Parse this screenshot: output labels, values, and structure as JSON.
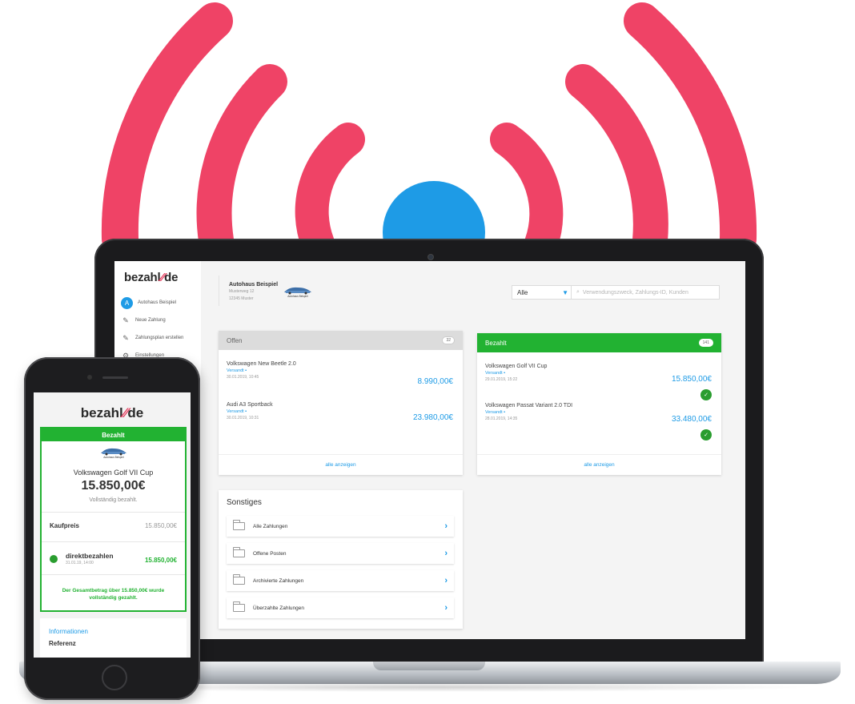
{
  "colors": {
    "wave": "#ef4366",
    "dot": "#1e9be6",
    "accent_green": "#22b232",
    "link_blue": "#1e9be6"
  },
  "desktop": {
    "logo": {
      "text_left": "bezahl",
      "slash": "⁄⁄",
      "text_right": "de"
    },
    "sidebar": {
      "account": {
        "avatar_letter": "A",
        "label": "Autohaus Beispiel"
      },
      "items": [
        {
          "label": "Neue Zahlung",
          "icon": "edit-icon"
        },
        {
          "label": "Zahlungsplan erstellen",
          "icon": "edit-icon"
        },
        {
          "label": "Einstellungen",
          "icon": "gear-icon"
        }
      ]
    },
    "company": {
      "name": "Autohaus Beispiel",
      "street": "Musterweg 12",
      "city": "12345 Muster",
      "logo_caption": "Autohaus Beispiel"
    },
    "filter": {
      "selected": "Alle"
    },
    "search": {
      "placeholder": "Verwendungszweck, Zahlungs-ID, Kunden"
    },
    "open_card": {
      "title": "Offen",
      "count": "32",
      "items": [
        {
          "title": "Volkswagen New Beetle 2.0",
          "status": "Versandt",
          "date": "30.01.2019, 10:45",
          "amount": "8.990,00€"
        },
        {
          "title": "Audi A3 Sportback",
          "status": "Versandt",
          "date": "30.01.2019, 10:31",
          "amount": "23.980,00€"
        }
      ],
      "footer": "alle anzeigen"
    },
    "paid_card": {
      "title": "Bezahlt",
      "count": "141",
      "items": [
        {
          "title": "Volkswagen Golf VII Cup",
          "status": "Versandt",
          "date": "29.01.2019, 15:22",
          "amount": "15.850,00€"
        },
        {
          "title": "Volkswagen Passat Variant 2.0 TDI",
          "status": "Versandt",
          "date": "28.01.2019, 14:35",
          "amount": "33.480,00€"
        }
      ],
      "footer": "alle anzeigen"
    },
    "misc_card": {
      "title": "Sonstiges",
      "items": [
        {
          "label": "Alle Zahlungen"
        },
        {
          "label": "Offene Posten"
        },
        {
          "label": "Archivierte Zahlungen"
        },
        {
          "label": "Überzahlte Zahlungen"
        }
      ]
    }
  },
  "phone": {
    "logo": {
      "text_left": "bezahl",
      "slash": "⁄⁄",
      "text_right": "de"
    },
    "card": {
      "header": "Bezahlt",
      "logo_caption": "Autohaus Beispiel",
      "title": "Volkswagen Golf VII Cup",
      "amount": "15.850,00€",
      "subtitle": "Vollständig bezahlt.",
      "kaufpreis_label": "Kaufpreis",
      "kaufpreis_value": "15.850,00€",
      "payment": {
        "name": "direktbezahlen",
        "date": "31.01.19, 14:00",
        "amount": "15.850,00€"
      },
      "note": "Der Gesamtbetrag über 15.850,00€ wurde vollständig gezahlt."
    },
    "info": {
      "heading": "Informationen",
      "label": "Referenz"
    }
  }
}
